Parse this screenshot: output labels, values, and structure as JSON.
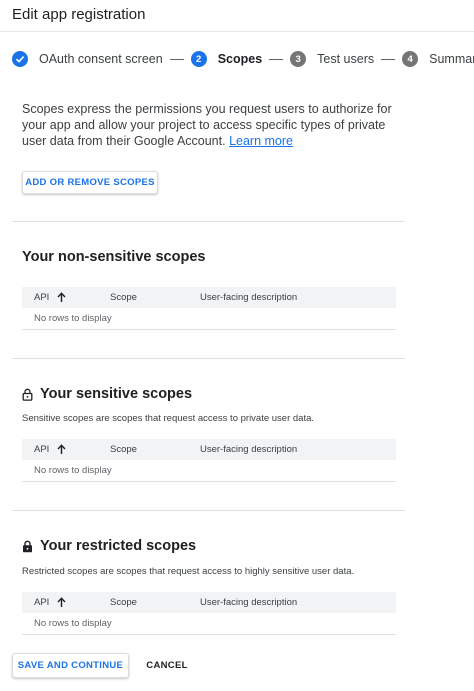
{
  "header": {
    "title": "Edit app registration"
  },
  "stepper": {
    "steps": [
      {
        "number": "",
        "label": "OAuth consent screen",
        "state": "completed",
        "icon": "check-icon"
      },
      {
        "number": "2",
        "label": "Scopes",
        "state": "active"
      },
      {
        "number": "3",
        "label": "Test users",
        "state": "pending"
      },
      {
        "number": "4",
        "label": "Summary",
        "state": "pending"
      }
    ]
  },
  "intro": {
    "text": "Scopes express the permissions you request users to authorize for your app and allow your project to access specific types of private user data from their Google Account.",
    "link": "Learn more"
  },
  "add_scopes_button": "ADD OR REMOVE SCOPES",
  "table_headers": {
    "api": "API",
    "scope": "Scope",
    "description": "User-facing description",
    "sort_icon": "arrow-up-icon"
  },
  "sections": {
    "non_sensitive": {
      "title": "Your non-sensitive scopes",
      "empty": "No rows to display"
    },
    "sensitive": {
      "title": "Your sensitive scopes",
      "icon": "lock-open-icon",
      "description": "Sensitive scopes are scopes that request access to private user data.",
      "empty": "No rows to display"
    },
    "restricted": {
      "title": "Your restricted scopes",
      "icon": "lock-icon",
      "description": "Restricted scopes are scopes that request access to highly sensitive user data.",
      "empty": "No rows to display"
    }
  },
  "footer": {
    "save": "SAVE AND CONTINUE",
    "cancel": "CANCEL"
  },
  "colors": {
    "accent": "#1a73e8",
    "pending_step": "#757575",
    "table_header_bg": "#f1f3f4"
  }
}
